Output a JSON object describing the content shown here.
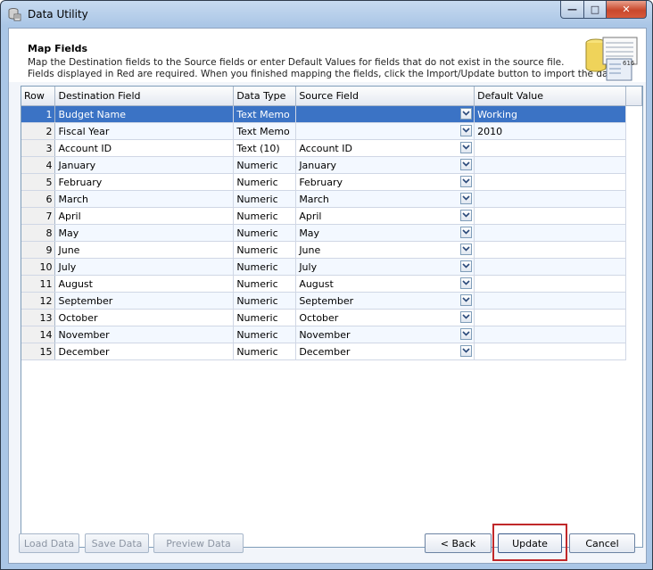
{
  "window": {
    "title": "Data Utility"
  },
  "header": {
    "title": "Map Fields",
    "line1": "Map the Destination fields to the Source fields or enter Default Values for fields that do not exist in the source file.",
    "line2": "Fields displayed in Red are required.  When you finished mapping the fields, click the Import/Update button to import the data.",
    "icon_badge": "616"
  },
  "grid": {
    "columns": [
      "Row",
      "Destination Field",
      "Data Type",
      "Source Field",
      "Default Value"
    ],
    "rows": [
      {
        "row": "1",
        "dest": "Budget Name",
        "type": "Text Memo",
        "source": "",
        "default": "Working"
      },
      {
        "row": "2",
        "dest": "Fiscal Year",
        "type": "Text Memo",
        "source": "",
        "default": "2010"
      },
      {
        "row": "3",
        "dest": "Account ID",
        "type": "Text (10)",
        "source": "Account ID",
        "default": ""
      },
      {
        "row": "4",
        "dest": "January",
        "type": "Numeric",
        "source": "January",
        "default": ""
      },
      {
        "row": "5",
        "dest": "February",
        "type": "Numeric",
        "source": "February",
        "default": ""
      },
      {
        "row": "6",
        "dest": "March",
        "type": "Numeric",
        "source": "March",
        "default": ""
      },
      {
        "row": "7",
        "dest": "April",
        "type": "Numeric",
        "source": "April",
        "default": ""
      },
      {
        "row": "8",
        "dest": "May",
        "type": "Numeric",
        "source": "May",
        "default": ""
      },
      {
        "row": "9",
        "dest": "June",
        "type": "Numeric",
        "source": "June",
        "default": ""
      },
      {
        "row": "10",
        "dest": "July",
        "type": "Numeric",
        "source": "July",
        "default": ""
      },
      {
        "row": "11",
        "dest": "August",
        "type": "Numeric",
        "source": "August",
        "default": ""
      },
      {
        "row": "12",
        "dest": "September",
        "type": "Numeric",
        "source": "September",
        "default": ""
      },
      {
        "row": "13",
        "dest": "October",
        "type": "Numeric",
        "source": "October",
        "default": ""
      },
      {
        "row": "14",
        "dest": "November",
        "type": "Numeric",
        "source": "November",
        "default": ""
      },
      {
        "row": "15",
        "dest": "December",
        "type": "Numeric",
        "source": "December",
        "default": ""
      }
    ]
  },
  "footer": {
    "load_data": "Load Data",
    "save_data": "Save Data",
    "preview_data": "Preview Data",
    "back": "< Back",
    "update": "Update",
    "cancel": "Cancel"
  },
  "colors": {
    "selection": "#3b73c5",
    "highlight_border": "#c0282a"
  }
}
